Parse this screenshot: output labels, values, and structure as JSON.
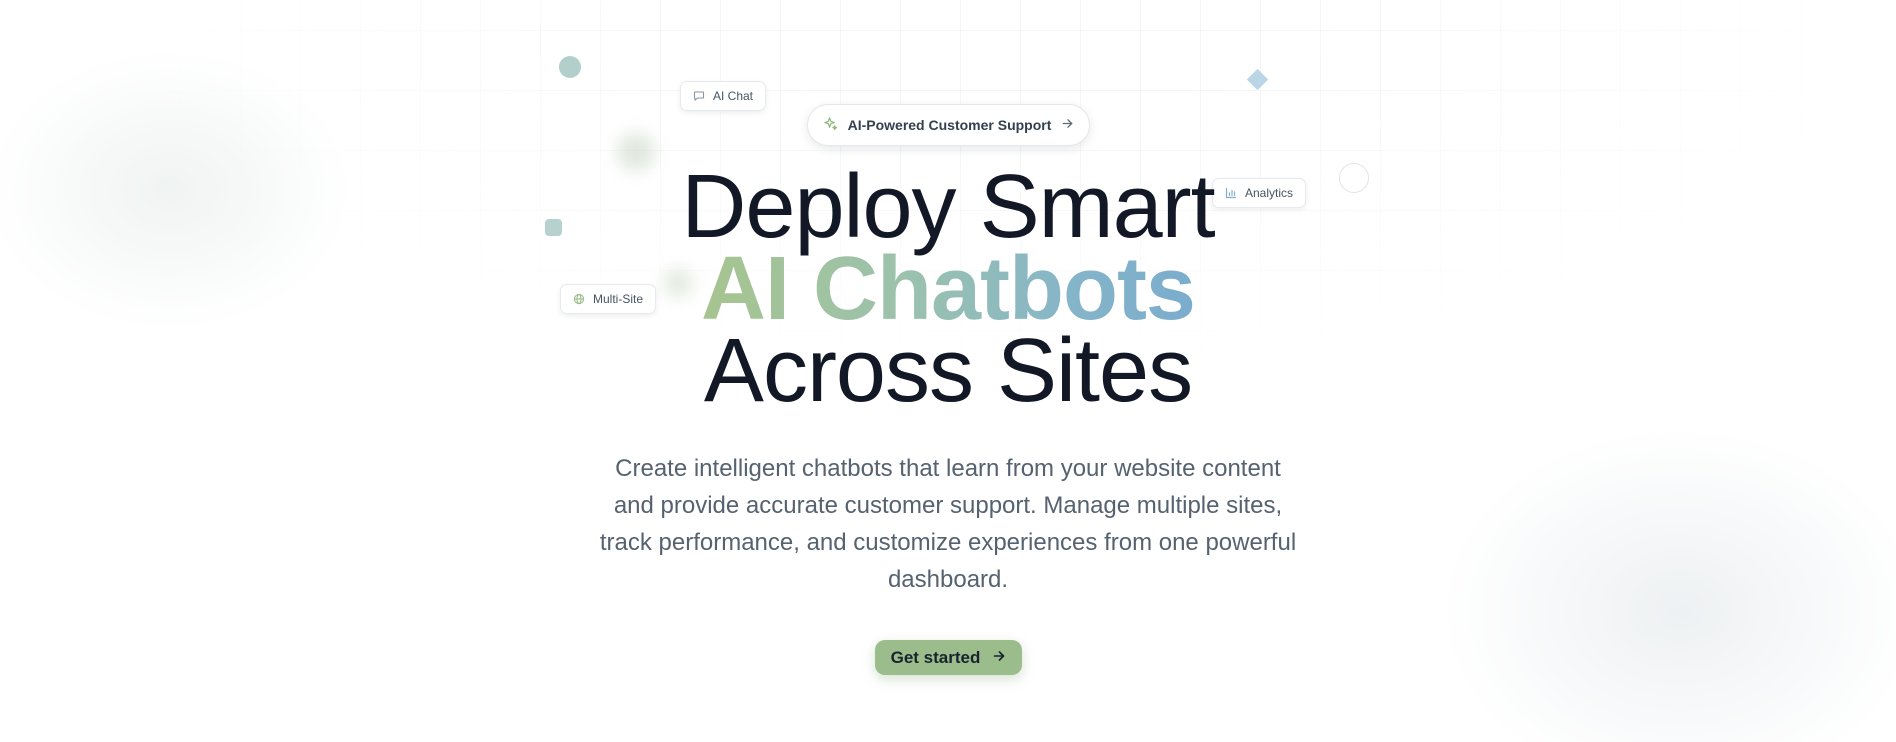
{
  "badges": {
    "ai_chat": "AI Chat",
    "analytics": "Analytics",
    "multi_site": "Multi-Site"
  },
  "announcement": {
    "label": "AI-Powered Customer Support",
    "icon": "sparkles-icon",
    "trailing_icon": "arrow-right-icon"
  },
  "hero": {
    "line1": "Deploy Smart",
    "line2": "AI Chatbots",
    "line3": "Across Sites",
    "description": "Create intelligent chatbots that learn from your website content and provide accurate customer support. Manage multiple sites, track performance, and customize experiences from one powerful dashboard."
  },
  "cta": {
    "label": "Get started",
    "icon": "arrow-right-icon"
  },
  "colors": {
    "heading": "#121826",
    "accent_start": "#a6c48f",
    "accent_end": "#7aaccc",
    "cta_background": "#9bbd8c",
    "body_text": "#566270"
  }
}
